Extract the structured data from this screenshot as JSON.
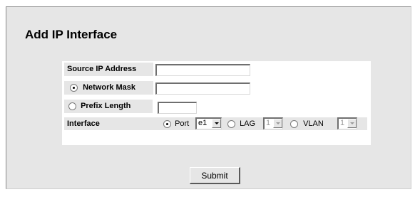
{
  "page": {
    "title": "Add IP Interface"
  },
  "form": {
    "source_ip": {
      "label": "Source IP Address",
      "value": ""
    },
    "network_mask": {
      "label": "Network Mask",
      "value": "",
      "selected": true
    },
    "prefix_length": {
      "label": "Prefix Length",
      "value": "",
      "selected": false
    },
    "interface": {
      "label": "Interface",
      "port": {
        "label": "Port",
        "value": "e1",
        "selected": true
      },
      "lag": {
        "label": "LAG",
        "value": "1",
        "selected": false
      },
      "vlan": {
        "label": "VLAN",
        "value": "1",
        "selected": false
      }
    }
  },
  "actions": {
    "submit_label": "Submit"
  }
}
